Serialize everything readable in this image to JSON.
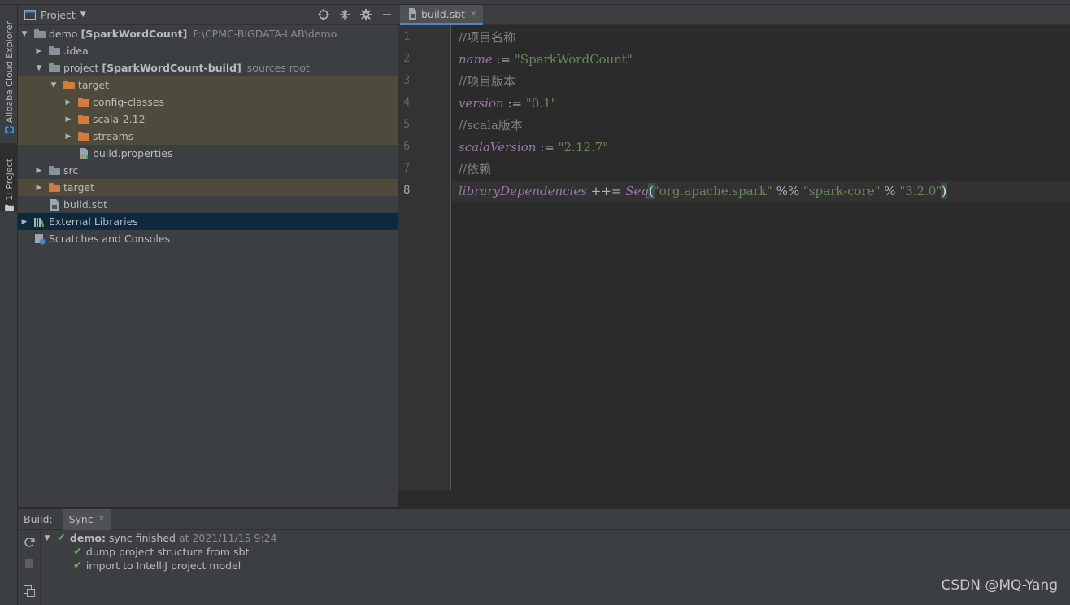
{
  "tool_stripe": {
    "alibaba_label": "Alibaba Cloud Explorer",
    "project_label": "1: Project"
  },
  "project_panel": {
    "title": "Project",
    "tree": [
      {
        "name": "demo",
        "bold": "[SparkWordCount]",
        "hint": "F:\\CPMC-BIGDATA-LAB\\demo"
      },
      {
        "name": ".idea"
      },
      {
        "name": "project",
        "bold": "[SparkWordCount-build]",
        "hint": "sources root"
      },
      {
        "name": "target"
      },
      {
        "name": "config-classes"
      },
      {
        "name": "scala-2.12"
      },
      {
        "name": "streams"
      },
      {
        "name": "build.properties"
      },
      {
        "name": "src"
      },
      {
        "name": "target"
      },
      {
        "name": "build.sbt"
      },
      {
        "name": "External Libraries"
      },
      {
        "name": "Scratches and Consoles"
      }
    ]
  },
  "editor": {
    "tab": "build.sbt",
    "line_numbers": [
      "1",
      "2",
      "3",
      "4",
      "5",
      "6",
      "7",
      "8"
    ],
    "lines": {
      "l1": {
        "comment": "//项目名称"
      },
      "l2": {
        "key": "name",
        "op": " := ",
        "value": "\"SparkWordCount\""
      },
      "l3": {
        "comment": "//项目版本"
      },
      "l4": {
        "key": "version",
        "op": " := ",
        "value": "\"0.1\""
      },
      "l5": {
        "comment": "//scala版本"
      },
      "l6": {
        "key": "scalaVersion",
        "op": " := ",
        "value": "\"2.12.7\""
      },
      "l7": {
        "comment": "//依赖"
      },
      "l8": {
        "key": "libraryDependencies",
        "op1": " ++= ",
        "fn": "Seq",
        "open": "(",
        "s1": "\"org.apache.spark\"",
        "op2": " %% ",
        "s2": "\"spark-core\"",
        "op3": " % ",
        "s3": "\"3.2.0\"",
        "close": ")"
      }
    }
  },
  "build_panel": {
    "label": "Build:",
    "tab": "Sync",
    "root": {
      "name": "demo:",
      "status": "sync finished",
      "time": "at 2021/11/15 9:24"
    },
    "children": [
      "dump project structure from sbt",
      "import to IntelliJ project model"
    ]
  },
  "watermark": "CSDN @MQ-Yang",
  "colors": {
    "accent": "#4a88c7",
    "excluded_bg": "#4e4b3c",
    "selected_bg": "#0d293e",
    "success": "#5fb857"
  }
}
